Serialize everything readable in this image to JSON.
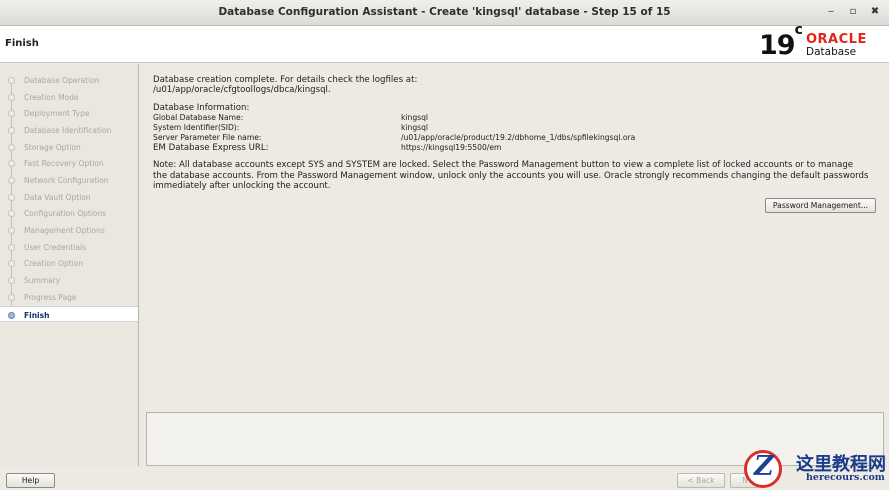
{
  "window": {
    "title": "Database Configuration Assistant - Create 'kingsql' database - Step 15 of 15",
    "minimize_glyph": "‒",
    "maximize_glyph": "▫",
    "close_glyph": "✖"
  },
  "header": {
    "step_title": "Finish",
    "brand_version": "19",
    "brand_version_suffix": "c",
    "brand_name": "ORACLE",
    "brand_product": "Database",
    "brand_color": "#e2231a"
  },
  "sidebar": {
    "items": [
      {
        "label": "Database Operation"
      },
      {
        "label": "Creation Mode"
      },
      {
        "label": "Deployment Type"
      },
      {
        "label": "Database Identification"
      },
      {
        "label": "Storage Option"
      },
      {
        "label": "Fast Recovery Option"
      },
      {
        "label": "Network Configuration"
      },
      {
        "label": "Data Vault Option"
      },
      {
        "label": "Configuration Options"
      },
      {
        "label": "Management Options"
      },
      {
        "label": "User Credentials"
      },
      {
        "label": "Creation Option"
      },
      {
        "label": "Summary"
      },
      {
        "label": "Progress Page"
      },
      {
        "label": "Finish"
      }
    ],
    "active_index": 14
  },
  "main": {
    "complete_line1": "Database creation complete. For details check the logfiles at:",
    "complete_line2": " /u01/app/oracle/cfgtoollogs/dbca/kingsql.",
    "info_heading": "Database Information:",
    "info": {
      "global_name_label": "Global Database Name:",
      "global_name_value": "kingsql",
      "sid_label": "System Identifier(SID):",
      "sid_value": "kingsql",
      "spfile_label": "Server Parameter File name:",
      "spfile_value": "/u01/app/oracle/product/19.2/dbhome_1/dbs/spfilekingsql.ora",
      "em_label": "EM Database Express URL:",
      "em_value": "https://kingsql19:5500/em"
    },
    "note": "Note: All database accounts except SYS and SYSTEM are locked. Select the Password Management button to view a complete list of locked accounts or to manage the database accounts. From the Password Management window, unlock only the accounts you will use. Oracle strongly recommends changing the default passwords immediately after unlocking the account.",
    "password_button": "Password Management..."
  },
  "footer": {
    "help_label": "Help",
    "back_label": "< Back",
    "next_label": "N"
  },
  "watermark": {
    "logo_letter": "Z",
    "site_name": "这里教程网",
    "site_url": "herecours.com"
  }
}
